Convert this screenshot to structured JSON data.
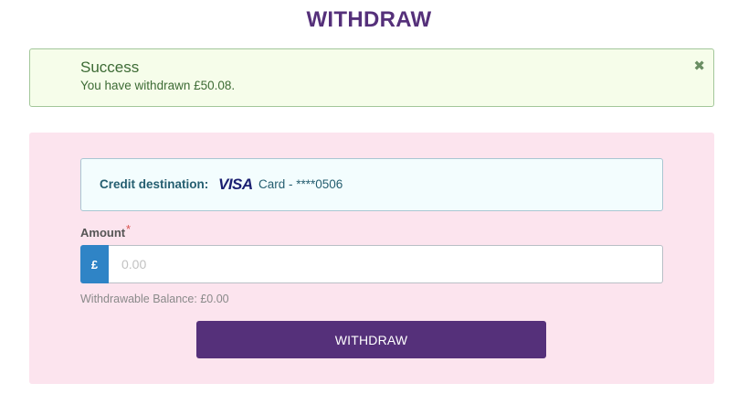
{
  "page": {
    "title": "WITHDRAW"
  },
  "alert": {
    "title": "Success",
    "message": "You have withdrawn £50.08.",
    "close_icon": "close-icon",
    "color": "#3d6b35"
  },
  "destination": {
    "label": "Credit destination:",
    "card_brand": "VISA",
    "card_text": "Card - ****0506"
  },
  "amount": {
    "label": "Amount",
    "required_mark": "*",
    "currency_symbol": "£",
    "placeholder": "0.00",
    "value": ""
  },
  "balance": {
    "text": "Withdrawable Balance: £0.00"
  },
  "actions": {
    "withdraw_label": "WITHDRAW"
  },
  "colors": {
    "brand": "#55307a",
    "currency_addon": "#2f84c6",
    "panel_bg": "#fce4ee",
    "success_bg": "#f6fdea"
  }
}
